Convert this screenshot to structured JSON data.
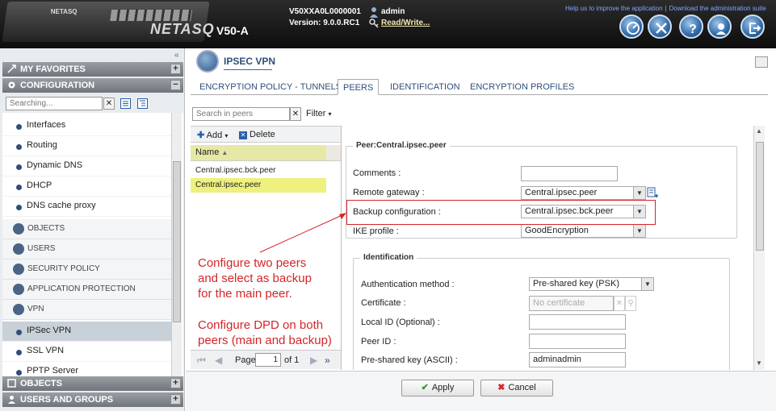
{
  "header": {
    "brand": "NETASQ",
    "device_label": "NETASQ",
    "model": "V50-A",
    "serial": "V50XXA0L0000001",
    "version": "Version: 9.0.0.RC1",
    "user": "admin",
    "access": "Read/Write...",
    "help_link": "Help us to improve the application",
    "download_link": "Download the administration suite"
  },
  "sidebar": {
    "favorites_label": "MY FAVORITES",
    "configuration_label": "CONFIGURATION",
    "search_placeholder": "Searching...",
    "items": [
      {
        "label": "Interfaces"
      },
      {
        "label": "Routing"
      },
      {
        "label": "Dynamic DNS"
      },
      {
        "label": "DHCP"
      },
      {
        "label": "DNS cache proxy"
      }
    ],
    "categories": [
      {
        "label": "OBJECTS"
      },
      {
        "label": "USERS"
      },
      {
        "label": "SECURITY POLICY"
      },
      {
        "label": "APPLICATION PROTECTION"
      },
      {
        "label": "VPN"
      }
    ],
    "vpn_items": [
      {
        "label": "IPSec VPN"
      },
      {
        "label": "SSL VPN"
      },
      {
        "label": "PPTP Server"
      }
    ],
    "objects_label": "OBJECTS",
    "users_groups_label": "USERS AND GROUPS"
  },
  "page": {
    "title": "IPSEC VPN",
    "tabs": [
      {
        "label": "ENCRYPTION POLICY - TUNNELS"
      },
      {
        "label": "PEERS"
      },
      {
        "label": "IDENTIFICATION"
      },
      {
        "label": "ENCRYPTION PROFILES"
      }
    ],
    "active_tab": "PEERS"
  },
  "peers": {
    "search_placeholder": "Search in peers",
    "filter_label": "Filter",
    "add_label": "Add",
    "delete_label": "Delete",
    "column_name": "Name",
    "rows": [
      {
        "name": "Central.ipsec.bck.peer"
      },
      {
        "name": "Central.ipsec.peer"
      }
    ],
    "page_label": "Page",
    "page_value": "1",
    "of_label": "of 1"
  },
  "form": {
    "peer_legend": "Peer:Central.ipsec.peer",
    "comments_label": "Comments :",
    "comments_value": "",
    "remote_gateway_label": "Remote gateway :",
    "remote_gateway_value": "Central.ipsec.peer",
    "backup_config_label": "Backup configuration :",
    "backup_config_value": "Central.ipsec.bck.peer",
    "ike_profile_label": "IKE profile :",
    "ike_profile_value": "GoodEncryption",
    "identification_legend": "Identification",
    "auth_method_label": "Authentication method :",
    "auth_method_value": "Pre-shared key (PSK)",
    "certificate_label": "Certificate :",
    "certificate_placeholder": "No certificate",
    "local_id_label": "Local ID (Optional) :",
    "local_id_value": "",
    "peer_id_label": "Peer ID :",
    "peer_id_value": "",
    "psk_label": "Pre-shared key (ASCII) :",
    "psk_value": "adminadmin"
  },
  "annotations": {
    "line1": "Configure two peers",
    "line2": "and select as backup",
    "line3": "for the main peer.",
    "line4": "Configure DPD on both",
    "line5": "peers (main and backup)"
  },
  "buttons": {
    "apply": "Apply",
    "cancel": "Cancel"
  },
  "colors": {
    "annotation_red": "#d3262a",
    "selected_row": "#eef17d",
    "header_dark": "#1a1a1a",
    "nav_blue": "#2f4f7a"
  }
}
